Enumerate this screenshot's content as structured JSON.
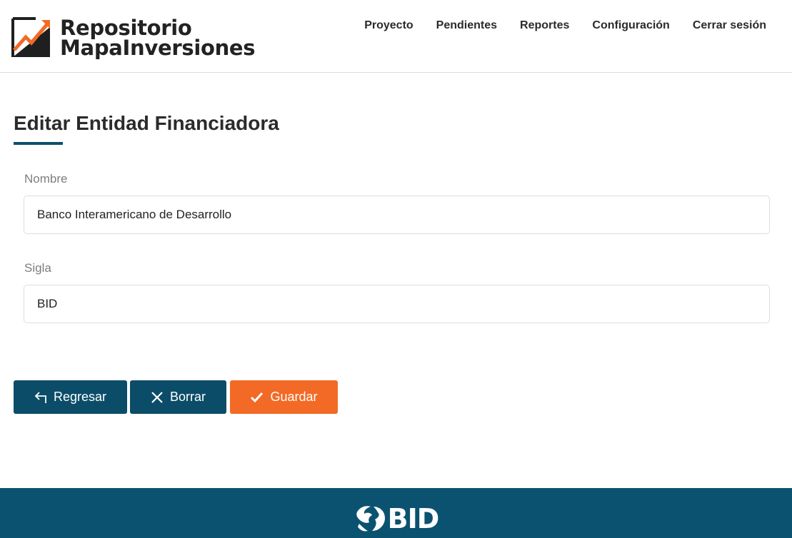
{
  "brand": {
    "line1": "Repositorio",
    "line2": "MapaInversiones"
  },
  "nav": [
    "Proyecto",
    "Pendientes",
    "Reportes",
    "Configuración",
    "Cerrar sesión"
  ],
  "page": {
    "title": "Editar Entidad Financiadora"
  },
  "form": {
    "nombre_label": "Nombre",
    "nombre_value": "Banco Interamericano de Desarrollo",
    "sigla_label": "Sigla",
    "sigla_value": "BID"
  },
  "buttons": {
    "back": "Regresar",
    "clear": "Borrar",
    "save": "Guardar"
  },
  "footer": {
    "logo_text": "BID"
  },
  "colors": {
    "primary": "#0b4d69",
    "accent": "#f26a25",
    "footer": "#0b5271"
  }
}
